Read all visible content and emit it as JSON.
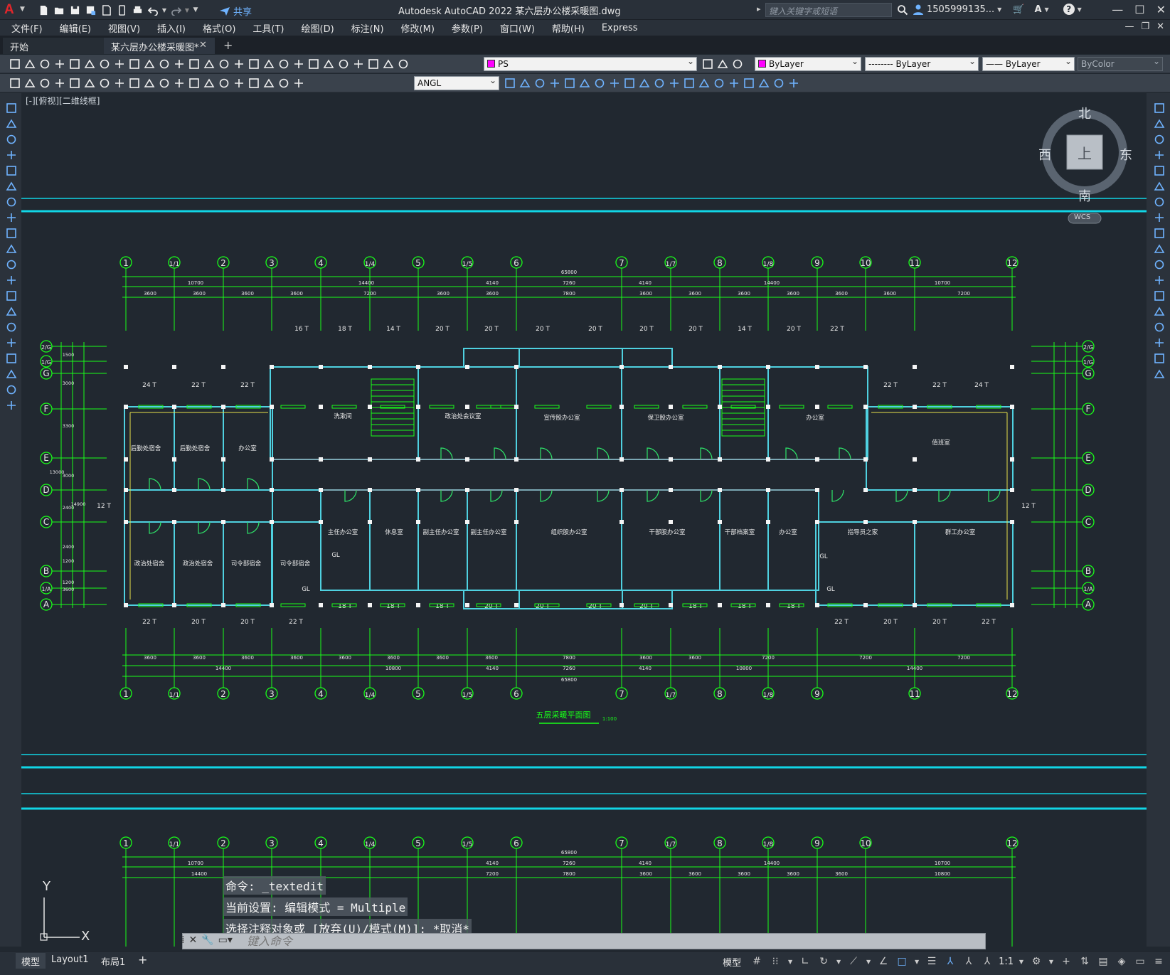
{
  "app": {
    "title": "Autodesk AutoCAD 2022    某六层办公楼采暖图.dwg",
    "share_label": "共享",
    "search_placeholder": "键入关键字或短语",
    "user_label": "1505999135...",
    "logo": "A"
  },
  "menu": {
    "items": [
      "文件(F)",
      "编辑(E)",
      "视图(V)",
      "插入(I)",
      "格式(O)",
      "工具(T)",
      "绘图(D)",
      "标注(N)",
      "修改(M)",
      "参数(P)",
      "窗口(W)",
      "帮助(H)",
      "Express"
    ]
  },
  "tabs": {
    "start_label": "开始",
    "drawing_label": "某六层办公楼采暖图*",
    "close_glyph": "✕",
    "add_glyph": "+"
  },
  "toolbar": {
    "layer_value": "PS",
    "layer_color": "#ff00ff",
    "color_value": "ByLayer",
    "linetype_value": "-------- ByLayer",
    "lineweight_value": "—— ByLayer",
    "plotstyle_value": "ByColor",
    "dimstyle_value": "ANGL"
  },
  "viewport": {
    "label": "[-][俯视][二维线框]"
  },
  "viewcube": {
    "north": "北",
    "south": "南",
    "east": "东",
    "west": "西",
    "face": "上",
    "wcs": "WCS"
  },
  "drawing": {
    "colors": {
      "background": "#212830",
      "wall": "#4fd1e0",
      "dim": "#19ff19",
      "text": "#e8e8e8",
      "door": "#2ee66a",
      "accent_red": "#ff3030",
      "yellow": "#e6e04a",
      "border": "#11d6e6"
    },
    "axis_top": [
      "1",
      "1/1",
      "2",
      "3",
      "4",
      "1/4",
      "5",
      "1/5",
      "6",
      "7",
      "1/7",
      "8",
      "1/8",
      "9",
      "10",
      "11",
      "12"
    ],
    "axis_bottom": [
      "1",
      "1/1",
      "2",
      "3",
      "4",
      "1/4",
      "5",
      "1/5",
      "6",
      "7",
      "1/7",
      "8",
      "1/8",
      "9",
      "11",
      "12"
    ],
    "axis_side": [
      "2/G",
      "1/G",
      "G",
      "F",
      "E",
      "D",
      "C",
      "B",
      "1/A",
      "A"
    ],
    "top_dims_total": "65800",
    "top_dims_row2": [
      "10700",
      "14400",
      "4140",
      "7260",
      "4140",
      "14400",
      "10700"
    ],
    "top_dims_row3": [
      "3600",
      "3600",
      "3600",
      "3600",
      "7200",
      "3600",
      "3600",
      "7800",
      "3600",
      "3600",
      "3600",
      "3600",
      "3600",
      "3600",
      "7200"
    ],
    "bottom_dims_row1": [
      "3600",
      "3600",
      "3600",
      "3600",
      "3600",
      "3600",
      "3600",
      "3600",
      "7800",
      "3600",
      "3600",
      "7200",
      "7200",
      "7200"
    ],
    "bottom_dims_row2": [
      "14400",
      "10800",
      "4140",
      "7260",
      "4140",
      "10800",
      "14400"
    ],
    "bottom_dims_total": "65800",
    "left_dims": [
      "1500",
      "3000",
      "3300",
      "3000",
      "2400",
      "2400",
      "3600",
      "1200",
      "1200",
      "13000",
      "14900"
    ],
    "radiator_top": [
      "16 T",
      "18 T",
      "14 T",
      "20 T",
      "20 T",
      "20 T",
      "20 T",
      "20 T",
      "20 T",
      "14 T",
      "20 T",
      "22 T"
    ],
    "radiator_upper_left": [
      "24 T",
      "22 T",
      "22 T"
    ],
    "radiator_upper_right": [
      "22 T",
      "22 T",
      "24 T"
    ],
    "radiator_mid_bottom": [
      "18 T",
      "18 T",
      "18 T",
      "20 T",
      "20 T",
      "20 T",
      "20 T",
      "18 T",
      "18 T",
      "18 T"
    ],
    "radiator_bottom_left": [
      "22 T",
      "20 T",
      "20 T",
      "22 T"
    ],
    "radiator_bottom_right": [
      "22 T",
      "20 T",
      "20 T",
      "22 T"
    ],
    "radiator_side": "12 T",
    "rooms_north": [
      "后勤处宿舍",
      "后勤处宿舍",
      "办公室",
      "洗漱间",
      "政治处会议室",
      "宣传股办公室",
      "保卫股办公室",
      "办公室",
      "值班室"
    ],
    "rooms_south": [
      "主任办公室",
      "休息室",
      "副主任办公室",
      "副主任办公室",
      "组织股办公室",
      "干部股办公室",
      "干部档案室",
      "办公室",
      "指导员之家",
      "群工办公室"
    ],
    "rooms_southwest": [
      "政治处宿舍",
      "政治处宿舍",
      "司令部宿舍",
      "司令部宿舍"
    ],
    "gl_labels": [
      "GL",
      "GL",
      "GL",
      "GL"
    ],
    "plan_title": "五层采暖平面图",
    "plan_scale": "1:100",
    "lower_axis": [
      "1",
      "1/1",
      "2",
      "3",
      "4",
      "1/4",
      "5",
      "1/5",
      "6",
      "7",
      "1/7",
      "8",
      "1/8",
      "9",
      "10",
      "12"
    ],
    "lower_dims_total": "65800",
    "lower_dims_row2": [
      "10700",
      "4140",
      "7260",
      "4140",
      "14400",
      "10700"
    ],
    "lower_dims_row3": [
      "14400",
      "7200",
      "7800",
      "3600",
      "3600",
      "3600",
      "3600",
      "3600",
      "10800"
    ]
  },
  "command": {
    "history": [
      "命令: _textedit",
      "当前设置: 编辑模式 = Multiple",
      "选择注释对象或 [放弃(U)/模式(M)]: *取消*"
    ],
    "input_placeholder": "键入命令"
  },
  "status": {
    "model_tab": "模型",
    "layout1_tab": "Layout1",
    "layout2_tab": "布局1",
    "add_tab": "+",
    "model_button": "模型",
    "scale": "1:1"
  },
  "ucs": {
    "x_label": "X",
    "y_label": "Y"
  }
}
